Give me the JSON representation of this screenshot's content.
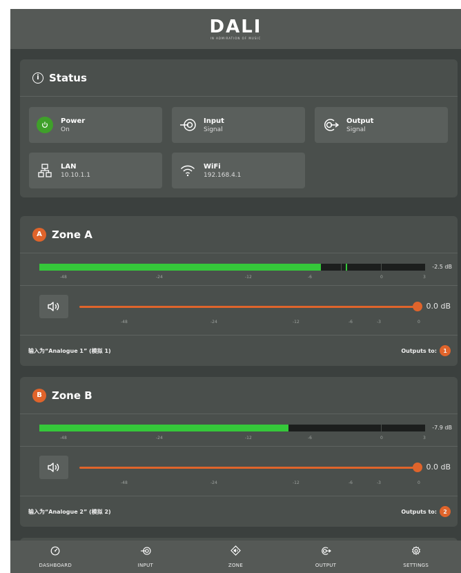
{
  "brand": {
    "name": "DALI",
    "tagline": "IN ADMIRATION OF MUSIC"
  },
  "status": {
    "title": "Status",
    "tiles": [
      {
        "label": "Power",
        "value": "On",
        "icon": "power-icon"
      },
      {
        "label": "Input",
        "value": "Signal",
        "icon": "input-icon"
      },
      {
        "label": "Output",
        "value": "Signal",
        "icon": "output-icon"
      },
      {
        "label": "LAN",
        "value": "10.10.1.1",
        "icon": "lan-icon"
      },
      {
        "label": "WiFi",
        "value": "192.168.4.1",
        "icon": "wifi-icon"
      }
    ]
  },
  "zones": [
    {
      "badge": "A",
      "title": "Zone A",
      "meter_db": "-2.5 dB",
      "meter_level": 0.73,
      "meter_peak": 0.795,
      "meter_scale": [
        "-48",
        "-24",
        "-12",
        "-6",
        "0",
        "3"
      ],
      "volume_db": "0.0 dB",
      "volume_level": 1.0,
      "volume_scale": [
        "-48",
        "-24",
        "-12",
        "-6",
        "-3",
        "0"
      ],
      "input_desc": "输入为“Analogue 1” (模拟 1)",
      "outputs_label": "Outputs to:",
      "output_num": "1"
    },
    {
      "badge": "B",
      "title": "Zone B",
      "meter_db": "-7.9 dB",
      "meter_level": 0.645,
      "meter_peak": null,
      "meter_scale": [
        "-48",
        "-24",
        "-12",
        "-6",
        "0",
        "3"
      ],
      "volume_db": "0.0 dB",
      "volume_level": 1.0,
      "volume_scale": [
        "-48",
        "-24",
        "-12",
        "-6",
        "-3",
        "0"
      ],
      "input_desc": "输入为“Analogue 2” (模拟 2)",
      "outputs_label": "Outputs to:",
      "output_num": "2"
    }
  ],
  "nav": [
    {
      "label": "DASHBOARD",
      "icon": "dashboard-icon"
    },
    {
      "label": "INPUT",
      "icon": "input-icon"
    },
    {
      "label": "ZONE",
      "icon": "zone-icon"
    },
    {
      "label": "OUTPUT",
      "icon": "output-icon"
    },
    {
      "label": "SETTINGS",
      "icon": "settings-icon"
    }
  ],
  "colors": {
    "accent": "#e0642b",
    "meter": "#35c83a",
    "power": "#3fa02a",
    "background": "#3b403e",
    "card": "#4a4f4c"
  }
}
